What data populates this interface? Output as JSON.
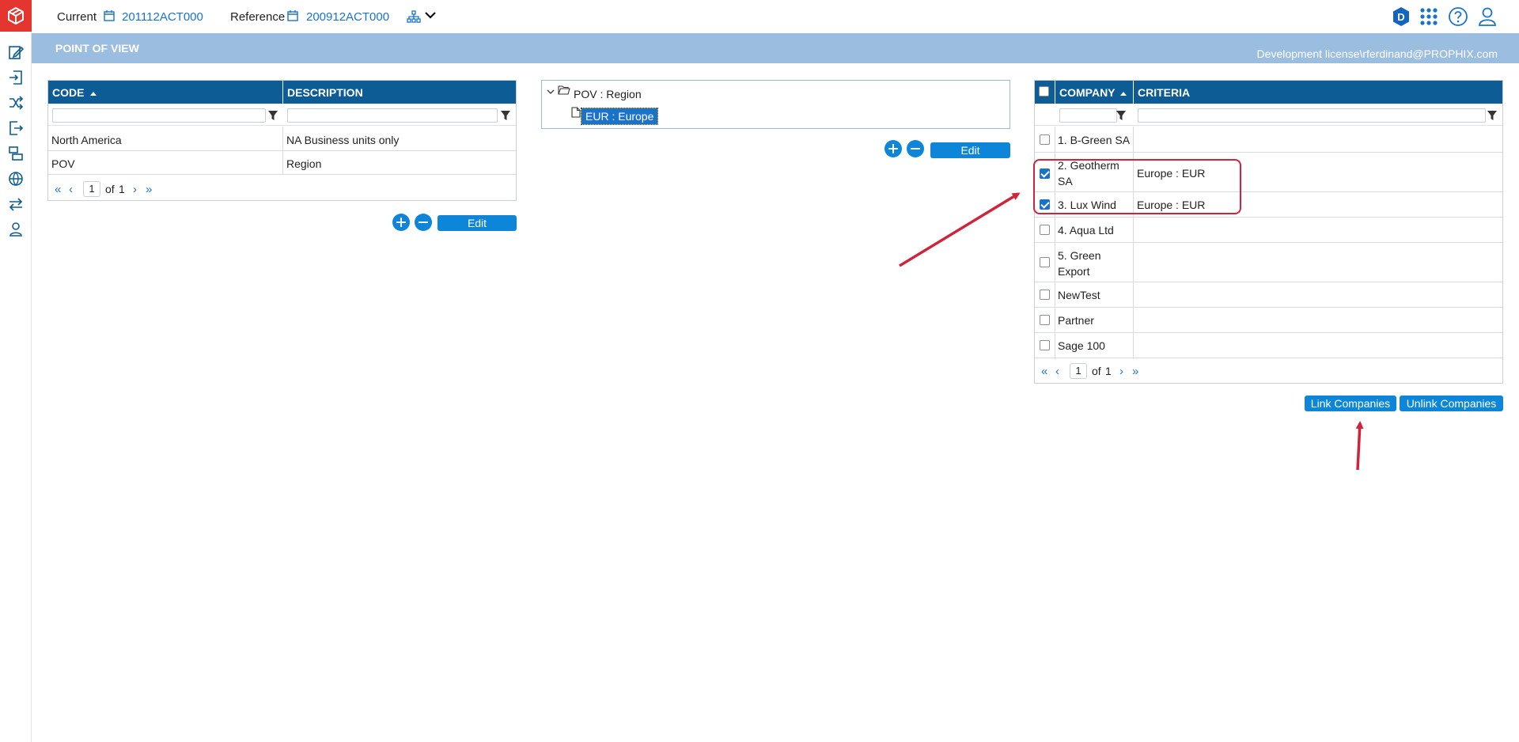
{
  "topbar": {
    "current_label": "Current",
    "current_value": "201112ACT000",
    "reference_label": "Reference",
    "reference_value": "200912ACT000",
    "user_badge": "D"
  },
  "band": {
    "title": "POINT OF VIEW",
    "license": "Development license\\rferdinand@PROPHIX.com"
  },
  "pov_grid": {
    "columns": [
      "CODE",
      "DESCRIPTION"
    ],
    "rows": [
      {
        "code": "North America",
        "description": "NA Business units only"
      },
      {
        "code": "POV",
        "description": "Region"
      }
    ],
    "page": "1",
    "of_label": "of",
    "total_pages": "1",
    "edit_label": "Edit"
  },
  "tree": {
    "root_label": "POV : Region",
    "child_label": "EUR : Europe",
    "edit_label": "Edit"
  },
  "company_grid": {
    "columns": [
      "COMPANY",
      "CRITERIA"
    ],
    "rows": [
      {
        "company": "1. B-Green SA",
        "criteria": "",
        "checked": false
      },
      {
        "company_line1": "2. Geotherm",
        "company_line2": "SA",
        "criteria": "Europe : EUR",
        "checked": true
      },
      {
        "company": "3. Lux Wind",
        "criteria": "Europe : EUR",
        "checked": true
      },
      {
        "company": "4. Aqua Ltd",
        "criteria": "",
        "checked": false
      },
      {
        "company_line1": "5. Green",
        "company_line2": "Export",
        "criteria": "",
        "checked": false
      },
      {
        "company": "NewTest",
        "criteria": "",
        "checked": false
      },
      {
        "company": "Partner",
        "criteria": "",
        "checked": false
      },
      {
        "company": "Sage 100",
        "criteria": "",
        "checked": false
      }
    ],
    "page": "1",
    "of_label": "of",
    "total_pages": "1",
    "link_label": "Link Companies",
    "unlink_label": "Unlink Companies"
  },
  "colors": {
    "header": "#0e5c96",
    "accent": "#0d86d9",
    "band": "#9bbde0",
    "annotation": "#d0243b"
  }
}
